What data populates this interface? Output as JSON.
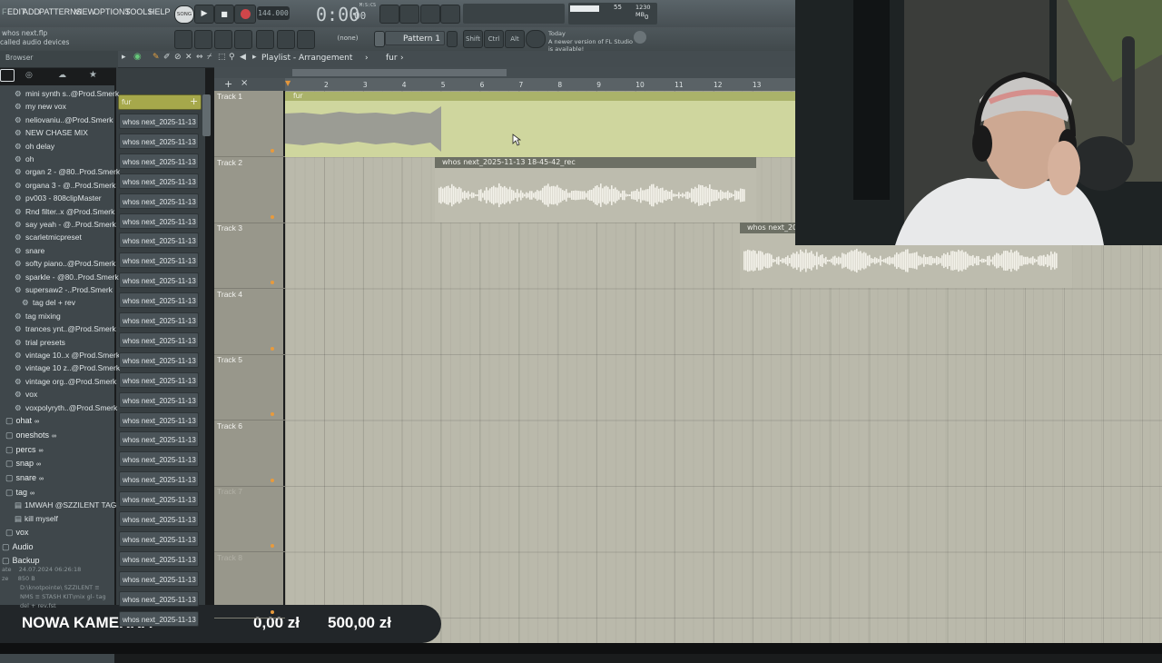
{
  "menu": [
    "EDIT",
    "ADD",
    "PATTERNS",
    "VIEW",
    "OPTIONS",
    "TOOLS",
    "HELP"
  ],
  "transport": {
    "mode": "SONG",
    "tempo": "144.000",
    "time": "0:00",
    "time_small": "00",
    "mcs": "M:S:CS"
  },
  "cpu": {
    "value": "55",
    "memory": "1230 MB",
    "voices": "0"
  },
  "hint": {
    "line1": "whos next.flp",
    "line2": "called audio devices"
  },
  "pattern": {
    "name": "Pattern 1",
    "channel": "(none)"
  },
  "modifiers": [
    "Shift",
    "Ctrl",
    "Alt"
  ],
  "news": {
    "day": "Today",
    "text": "A newer version of FL Studio is available!"
  },
  "browser": {
    "title": "Browser",
    "items": [
      "mini synth s..@Prod.Smerk",
      "my new vox",
      "neliovaniu..@Prod.Smerk",
      "NEW CHASE MIX",
      "oh delay",
      "oh",
      "organ 2 - @80..Prod.Smerk",
      "organa 3 - @..Prod.Smerk",
      "pv003 - 808clipMaster",
      "Rnd filter..x @Prod.Smerk",
      "say yeah - @..Prod.Smerk",
      "scarletmicpreset",
      "snare",
      "softy piano..@Prod.Smerk",
      "sparkle - @80..Prod.Smerk",
      "supersaw2 -..Prod.Smerk",
      "tag del + rev",
      "tag mixing",
      "trances ynt..@Prod.Smerk",
      "trial presets",
      "vintage 10..x @Prod.Smerk",
      "vintage 10 z..@Prod.Smerk",
      "vintage org..@Prod.Smerk",
      "vox",
      "voxpolyryth..@Prod.Smerk"
    ],
    "folders": [
      "ohat",
      "oneshots",
      "percs",
      "snap",
      "snare",
      "tag"
    ],
    "tag_items": [
      "1MWAH @SZZILENT TAG",
      "kill myself"
    ],
    "folders2": [
      "vox",
      "Audio",
      "Backup"
    ],
    "info": {
      "date": "24.07.2024 06:26:18",
      "size": "850 B",
      "path": "D:\\knotpointe\\ SZZILENT ≡ NMS ≡ STASH KIT\\mix gl- tag del + rev.fst"
    }
  },
  "picker": {
    "first": "fur",
    "clip_label": "whos next_2025-11-13 1..."
  },
  "playlist": {
    "title": "Playlist - Arrangement",
    "pattern": "fur"
  },
  "ruler": [
    "2",
    "3",
    "4",
    "5",
    "6",
    "7",
    "8",
    "9",
    "10",
    "11",
    "12",
    "13"
  ],
  "tracks": [
    "Track 1",
    "Track 2",
    "Track 3",
    "Track 4",
    "Track 5",
    "Track 6",
    "Track 7",
    "Track 8"
  ],
  "clips": {
    "fur": "fur",
    "rec": "whos next_2025-11-13 18-45-42_rec",
    "rec3": "whos next_20"
  },
  "banner": {
    "title": "NOWA KAMERKA",
    "amount": "0,00 zł",
    "goal": "500,00 zł"
  },
  "colors": {
    "accent": "#e89a3c",
    "clip_green": "#cfd69e",
    "grid": "#bab9ab"
  }
}
